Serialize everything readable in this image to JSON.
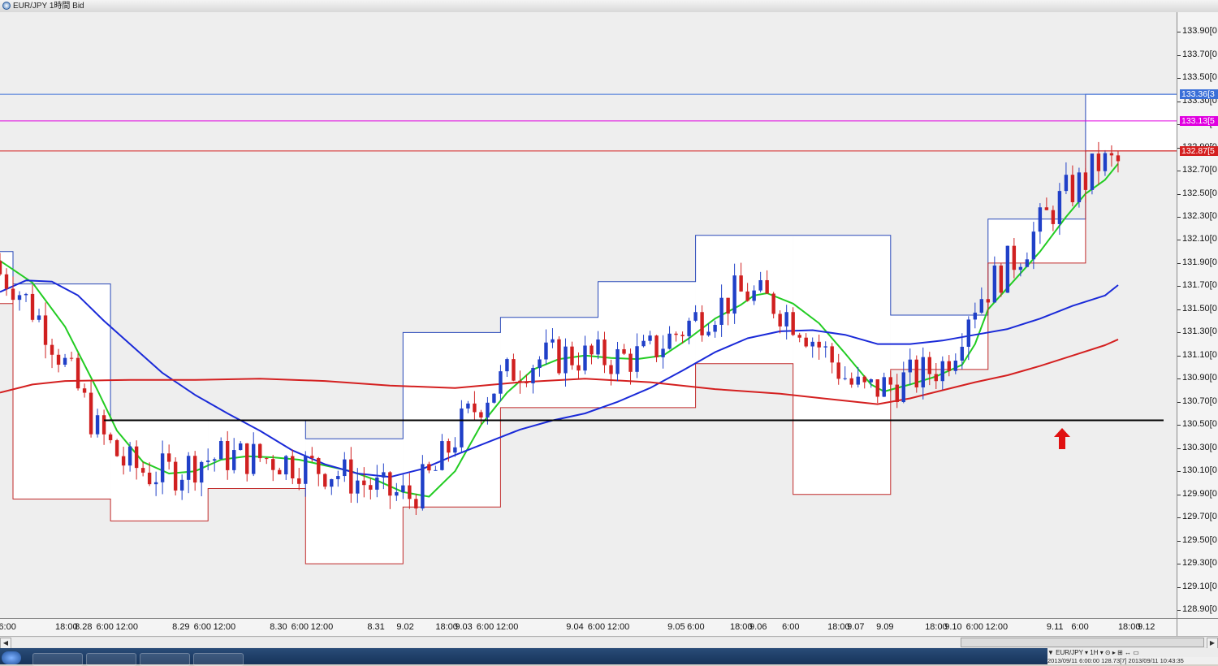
{
  "window": {
    "title": "EUR/JPY 1時間 Bid"
  },
  "price_axis": {
    "min": 128.83,
    "max": 134.07,
    "labels": [
      "133.90[0",
      "133.70[0",
      "133.50[0",
      "133.30[0",
      "133.10[0",
      "132.90[0",
      "132.70[0",
      "132.50[0",
      "132.30[0",
      "132.10[0",
      "131.90[0",
      "131.70[0",
      "131.50[0",
      "131.30[0",
      "131.10[0",
      "130.90[0",
      "130.70[0",
      "130.50[0",
      "130.30[0",
      "130.10[0",
      "129.90[0",
      "129.70[0",
      "129.50[0",
      "129.30[0",
      "129.10[0",
      "128.90[0"
    ],
    "current_ask_label": "133.36[3",
    "current_price_label": "133.13[5",
    "current_bid_label": "132.87[5",
    "colors": {
      "ask": "#3a6fd8",
      "price": "#e000e0",
      "bid": "#d42020"
    }
  },
  "time_axis": {
    "labels": [
      {
        "t": 0.3,
        "text": "6:00"
      },
      {
        "t": 9.0,
        "text": "18:00"
      },
      {
        "t": 12.0,
        "text": "8.28"
      },
      {
        "t": 15.3,
        "text": "6:00"
      },
      {
        "t": 18.3,
        "text": "12:00"
      },
      {
        "t": 27.0,
        "text": "8.29"
      },
      {
        "t": 30.3,
        "text": "6:00"
      },
      {
        "t": 33.3,
        "text": "12:00"
      },
      {
        "t": 42.0,
        "text": "8.30"
      },
      {
        "t": 45.3,
        "text": "6:00"
      },
      {
        "t": 48.3,
        "text": "12:00"
      },
      {
        "t": 57.0,
        "text": "8.31"
      },
      {
        "t": 61.5,
        "text": "9.02"
      },
      {
        "t": 67.5,
        "text": "18:00"
      },
      {
        "t": 70.5,
        "text": "9.03"
      },
      {
        "t": 73.8,
        "text": "6:00"
      },
      {
        "t": 76.8,
        "text": "12:00"
      },
      {
        "t": 87.6,
        "text": "9.04"
      },
      {
        "t": 90.9,
        "text": "6:00"
      },
      {
        "t": 93.9,
        "text": "12:00"
      },
      {
        "t": 103.2,
        "text": "9.05"
      },
      {
        "t": 106.2,
        "text": "6:00"
      },
      {
        "t": 112.8,
        "text": "18:00"
      },
      {
        "t": 115.8,
        "text": "9.06"
      },
      {
        "t": 120.8,
        "text": "6:00"
      },
      {
        "t": 127.8,
        "text": "18:00"
      },
      {
        "t": 130.8,
        "text": "9.07"
      },
      {
        "t": 135.3,
        "text": "9.09"
      },
      {
        "t": 142.8,
        "text": "18:00"
      },
      {
        "t": 145.8,
        "text": "9.10"
      },
      {
        "t": 149.1,
        "text": "6:00"
      },
      {
        "t": 152.1,
        "text": "12:00"
      },
      {
        "t": 161.5,
        "text": "9.11"
      },
      {
        "t": 165.3,
        "text": "6:00"
      },
      {
        "t": 172.5,
        "text": "18:00"
      },
      {
        "t": 175.5,
        "text": "9.12"
      }
    ]
  },
  "chart_data": {
    "type": "candlestick",
    "instrument": "EUR/JPY",
    "timeframe": "1時間 Bid",
    "ylim": [
      128.83,
      134.07
    ],
    "xlim": [
      0,
      181
    ],
    "candle_colors": {
      "up": "#2040c8",
      "down": "#d02020"
    },
    "price_lines": [
      {
        "price": 133.36,
        "color": "#3a6fd8"
      },
      {
        "price": 133.13,
        "color": "#e000e0"
      },
      {
        "price": 132.87,
        "color": "#d42020"
      }
    ],
    "horizontal_line": {
      "price": 130.54,
      "color": "#000000",
      "x_from": 16,
      "x_to": 179
    },
    "high_steps": [
      {
        "x0": -3,
        "x1": 2,
        "price": 132.0
      },
      {
        "x0": 2,
        "x1": 17,
        "price": 131.72
      },
      {
        "x0": 17,
        "x1": 32,
        "price": 130.54
      },
      {
        "x0": 32,
        "x1": 47,
        "price": 130.54
      },
      {
        "x0": 47,
        "x1": 62,
        "price": 130.38
      },
      {
        "x0": 62,
        "x1": 77,
        "price": 131.3
      },
      {
        "x0": 77,
        "x1": 92,
        "price": 131.43
      },
      {
        "x0": 92,
        "x1": 107,
        "price": 131.74
      },
      {
        "x0": 107,
        "x1": 122,
        "price": 132.14
      },
      {
        "x0": 122,
        "x1": 137,
        "price": 132.14
      },
      {
        "x0": 137,
        "x1": 152,
        "price": 131.45
      },
      {
        "x0": 152,
        "x1": 167,
        "price": 132.28
      },
      {
        "x0": 167,
        "x1": 182,
        "price": 133.36
      }
    ],
    "low_steps": [
      {
        "x0": -3,
        "x1": 2,
        "price": 131.55
      },
      {
        "x0": 2,
        "x1": 17,
        "price": 129.86
      },
      {
        "x0": 17,
        "x1": 32,
        "price": 129.67
      },
      {
        "x0": 32,
        "x1": 47,
        "price": 129.95
      },
      {
        "x0": 47,
        "x1": 62,
        "price": 129.3
      },
      {
        "x0": 62,
        "x1": 77,
        "price": 129.79
      },
      {
        "x0": 77,
        "x1": 92,
        "price": 130.65
      },
      {
        "x0": 92,
        "x1": 107,
        "price": 130.65
      },
      {
        "x0": 107,
        "x1": 122,
        "price": 131.03
      },
      {
        "x0": 122,
        "x1": 137,
        "price": 129.9
      },
      {
        "x0": 137,
        "x1": 152,
        "price": 130.98
      },
      {
        "x0": 152,
        "x1": 167,
        "price": 131.9
      },
      {
        "x0": 167,
        "x1": 182,
        "price": 132.87
      }
    ],
    "series": [
      {
        "name": "",
        "color": "#22cc22",
        "points": [
          [
            0,
            131.92
          ],
          [
            5,
            131.73
          ],
          [
            10,
            131.35
          ],
          [
            15,
            130.8
          ],
          [
            18,
            130.45
          ],
          [
            22,
            130.18
          ],
          [
            26,
            130.08
          ],
          [
            30,
            130.1
          ],
          [
            34,
            130.2
          ],
          [
            38,
            130.23
          ],
          [
            42,
            130.22
          ],
          [
            46,
            130.2
          ],
          [
            50,
            130.15
          ],
          [
            54,
            130.1
          ],
          [
            58,
            130.02
          ],
          [
            62,
            129.92
          ],
          [
            66,
            129.88
          ],
          [
            70,
            130.1
          ],
          [
            74,
            130.5
          ],
          [
            78,
            130.78
          ],
          [
            82,
            130.98
          ],
          [
            86,
            131.07
          ],
          [
            90,
            131.1
          ],
          [
            94,
            131.08
          ],
          [
            98,
            131.07
          ],
          [
            102,
            131.1
          ],
          [
            106,
            131.25
          ],
          [
            110,
            131.42
          ],
          [
            114,
            131.54
          ],
          [
            116,
            131.62
          ],
          [
            118,
            131.64
          ],
          [
            122,
            131.55
          ],
          [
            126,
            131.38
          ],
          [
            130,
            131.12
          ],
          [
            134,
            130.85
          ],
          [
            136,
            130.79
          ],
          [
            140,
            130.85
          ],
          [
            144,
            130.92
          ],
          [
            148,
            131.02
          ],
          [
            150,
            131.2
          ],
          [
            152,
            131.5
          ],
          [
            156,
            131.75
          ],
          [
            160,
            132.0
          ],
          [
            164,
            132.3
          ],
          [
            167,
            132.5
          ],
          [
            170,
            132.62
          ],
          [
            172,
            132.76
          ]
        ]
      },
      {
        "name": "",
        "color": "#1a2ad8",
        "points": [
          [
            0,
            131.65
          ],
          [
            4,
            131.75
          ],
          [
            8,
            131.74
          ],
          [
            12,
            131.62
          ],
          [
            16,
            131.4
          ],
          [
            20,
            131.2
          ],
          [
            25,
            130.95
          ],
          [
            30,
            130.76
          ],
          [
            35,
            130.6
          ],
          [
            40,
            130.45
          ],
          [
            45,
            130.28
          ],
          [
            50,
            130.16
          ],
          [
            55,
            130.08
          ],
          [
            60,
            130.05
          ],
          [
            65,
            130.12
          ],
          [
            70,
            130.24
          ],
          [
            75,
            130.35
          ],
          [
            80,
            130.46
          ],
          [
            85,
            130.54
          ],
          [
            90,
            130.6
          ],
          [
            95,
            130.7
          ],
          [
            100,
            130.82
          ],
          [
            105,
            130.97
          ],
          [
            110,
            131.13
          ],
          [
            115,
            131.25
          ],
          [
            120,
            131.31
          ],
          [
            125,
            131.32
          ],
          [
            130,
            131.28
          ],
          [
            135,
            131.2
          ],
          [
            140,
            131.2
          ],
          [
            145,
            131.23
          ],
          [
            150,
            131.28
          ],
          [
            155,
            131.33
          ],
          [
            160,
            131.42
          ],
          [
            165,
            131.53
          ],
          [
            170,
            131.62
          ],
          [
            172,
            131.71
          ]
        ]
      },
      {
        "name": "",
        "color": "#d42020",
        "points": [
          [
            0,
            130.78
          ],
          [
            5,
            130.85
          ],
          [
            10,
            130.88
          ],
          [
            20,
            130.89
          ],
          [
            30,
            130.89
          ],
          [
            40,
            130.9
          ],
          [
            50,
            130.88
          ],
          [
            60,
            130.84
          ],
          [
            70,
            130.82
          ],
          [
            80,
            130.87
          ],
          [
            90,
            130.9
          ],
          [
            100,
            130.87
          ],
          [
            110,
            130.81
          ],
          [
            120,
            130.77
          ],
          [
            130,
            130.71
          ],
          [
            135,
            130.68
          ],
          [
            140,
            130.73
          ],
          [
            145,
            130.8
          ],
          [
            150,
            130.87
          ],
          [
            155,
            130.93
          ],
          [
            160,
            131.01
          ],
          [
            165,
            131.1
          ],
          [
            170,
            131.19
          ],
          [
            172,
            131.24
          ]
        ]
      }
    ]
  },
  "status": {
    "toolbar_text": "▼ EUR/JPY ▾ 1H ▾ ⊙ ▸ ⊞ ↔ ▭",
    "info_text": "2013/09/11 6:00:00 128.73[7] 2013/09/11 10:43:35"
  }
}
